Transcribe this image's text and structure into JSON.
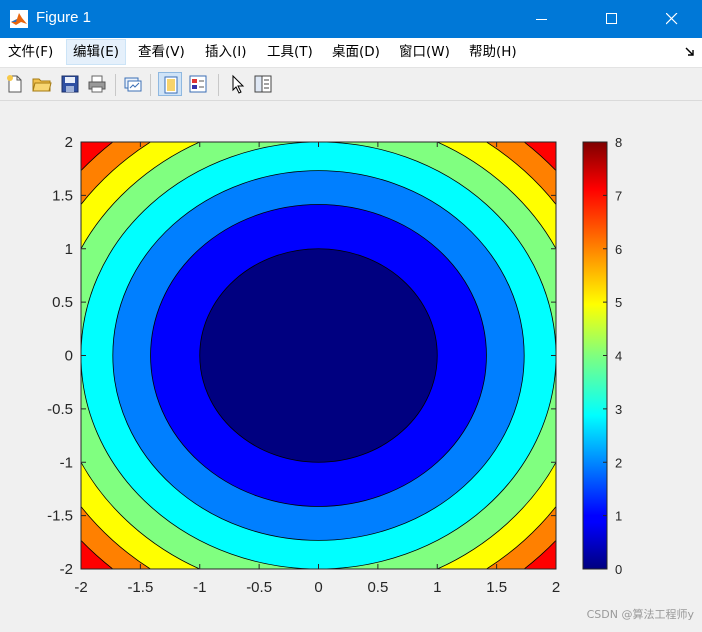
{
  "window": {
    "title": "Figure 1",
    "titlebar_color": "#0078d7"
  },
  "menu": {
    "items": [
      {
        "label": "文件(F)"
      },
      {
        "label": "编辑(E)"
      },
      {
        "label": "查看(V)"
      },
      {
        "label": "插入(I)"
      },
      {
        "label": "工具(T)"
      },
      {
        "label": "桌面(D)"
      },
      {
        "label": "窗口(W)"
      },
      {
        "label": "帮助(H)"
      }
    ],
    "active_item": "编辑(E)"
  },
  "toolbar": {
    "buttons": [
      {
        "icon": "new-figure-icon"
      },
      {
        "icon": "open-file-icon"
      },
      {
        "icon": "save-icon"
      },
      {
        "icon": "print-icon"
      },
      {
        "icon": "link-plot-icon"
      },
      {
        "icon": "hide-plot-tools-icon",
        "pressed": true
      },
      {
        "icon": "show-plot-tools-icon"
      },
      {
        "icon": "edit-plot-arrow-icon"
      },
      {
        "icon": "dock-panel-icon"
      }
    ]
  },
  "chart_data": {
    "type": "contourf",
    "function": "z = x^2 + y^2",
    "x": {
      "ticks": [
        "-2",
        "-1.5",
        "-1",
        "-0.5",
        "0",
        "0.5",
        "1",
        "1.5",
        "2"
      ],
      "lim": [
        -2,
        2
      ]
    },
    "y": {
      "ticks": [
        "-2",
        "-1.5",
        "-1",
        "-0.5",
        "0",
        "0.5",
        "1",
        "1.5",
        "2"
      ],
      "lim": [
        -2,
        2
      ]
    },
    "levels": [
      0,
      1,
      2,
      3,
      4,
      5,
      6,
      7,
      8
    ],
    "level_colors": [
      "#000080",
      "#0000ff",
      "#007fff",
      "#00ffff",
      "#80ff80",
      "#ffff00",
      "#ff8000",
      "#ff0000"
    ],
    "colorbar": {
      "ticks": [
        "0",
        "1",
        "2",
        "3",
        "4",
        "5",
        "6",
        "7",
        "8"
      ],
      "lim": [
        0,
        8
      ],
      "colormap": "jet"
    }
  },
  "watermark": "CSDN @算法工程师y"
}
